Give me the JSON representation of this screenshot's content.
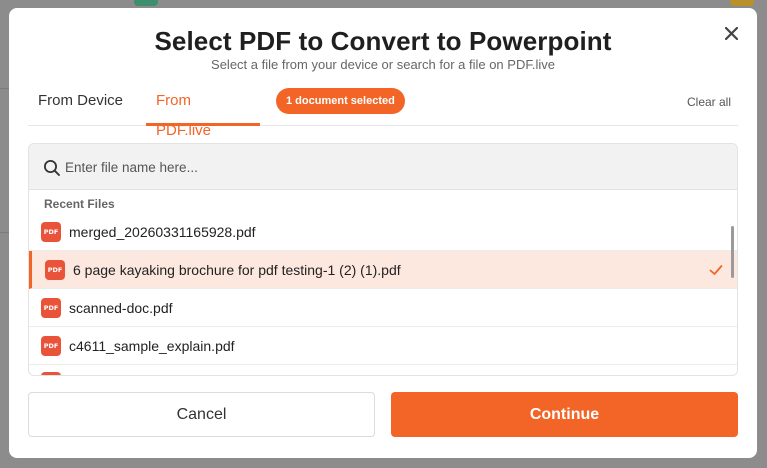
{
  "modal": {
    "title": "Select PDF to Convert to Powerpoint",
    "subtitle": "Select a file from your device or search for a file on PDF.live"
  },
  "tabs": [
    {
      "label": "From Device",
      "active": false
    },
    {
      "label": "From PDF.live",
      "active": true
    }
  ],
  "selection_badge": "1 document selected",
  "clear_all_label": "Clear all",
  "search": {
    "placeholder": "Enter file name here...",
    "value": ""
  },
  "recent_files_label": "Recent Files",
  "file_icon_text": "PDF",
  "files": [
    {
      "name": "merged_20260331165928.pdf",
      "selected": false
    },
    {
      "name": "6 page kayaking brochure for pdf testing-1 (2) (1).pdf",
      "selected": true
    },
    {
      "name": "scanned-doc.pdf",
      "selected": false
    },
    {
      "name": "c4611_sample_explain.pdf",
      "selected": false
    }
  ],
  "buttons": {
    "cancel": "Cancel",
    "continue": "Continue"
  },
  "colors": {
    "accent": "#f26527",
    "selected_row_bg": "#fde8df",
    "pdf_icon": "#e8533a"
  },
  "icons": [
    "close-icon",
    "search-icon",
    "pdf-file-icon",
    "check-icon"
  ]
}
